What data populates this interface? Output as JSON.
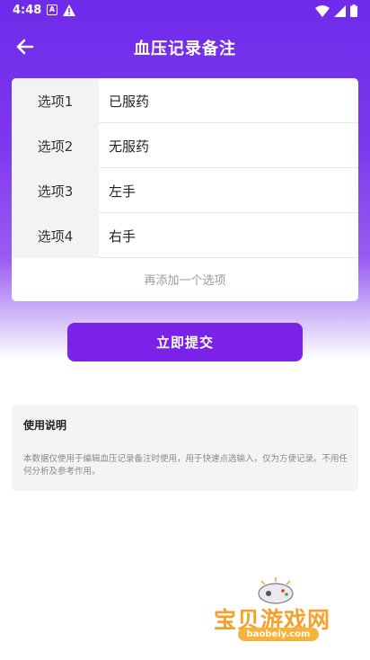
{
  "status_bar": {
    "time": "4:48",
    "left_icons": [
      "a-badge-icon",
      "warning-icon"
    ],
    "right_icons": [
      "wifi-icon",
      "signal-icon",
      "battery-icon"
    ]
  },
  "header": {
    "title": "血压记录备注",
    "back_icon": "back-arrow-icon"
  },
  "options": [
    {
      "label": "选项1",
      "value": "已服药"
    },
    {
      "label": "选项2",
      "value": "无服药"
    },
    {
      "label": "选项3",
      "value": "左手"
    },
    {
      "label": "选项4",
      "value": "右手"
    }
  ],
  "add_option_label": "再添加一个选项",
  "submit_label": "立即提交",
  "instructions": {
    "title": "使用说明",
    "body": "本数据仅使用于编辑血压记录备注时使用，用于快速点选输入，仅为方便记录。不用任何分析及参考作用。"
  },
  "watermark": {
    "text": "宝贝游戏网",
    "url": "baobeiy.com"
  },
  "colors": {
    "accent": "#7b22e8",
    "header_gradient_top": "#6f2bea",
    "watermark_orange": "#f3a12a"
  }
}
